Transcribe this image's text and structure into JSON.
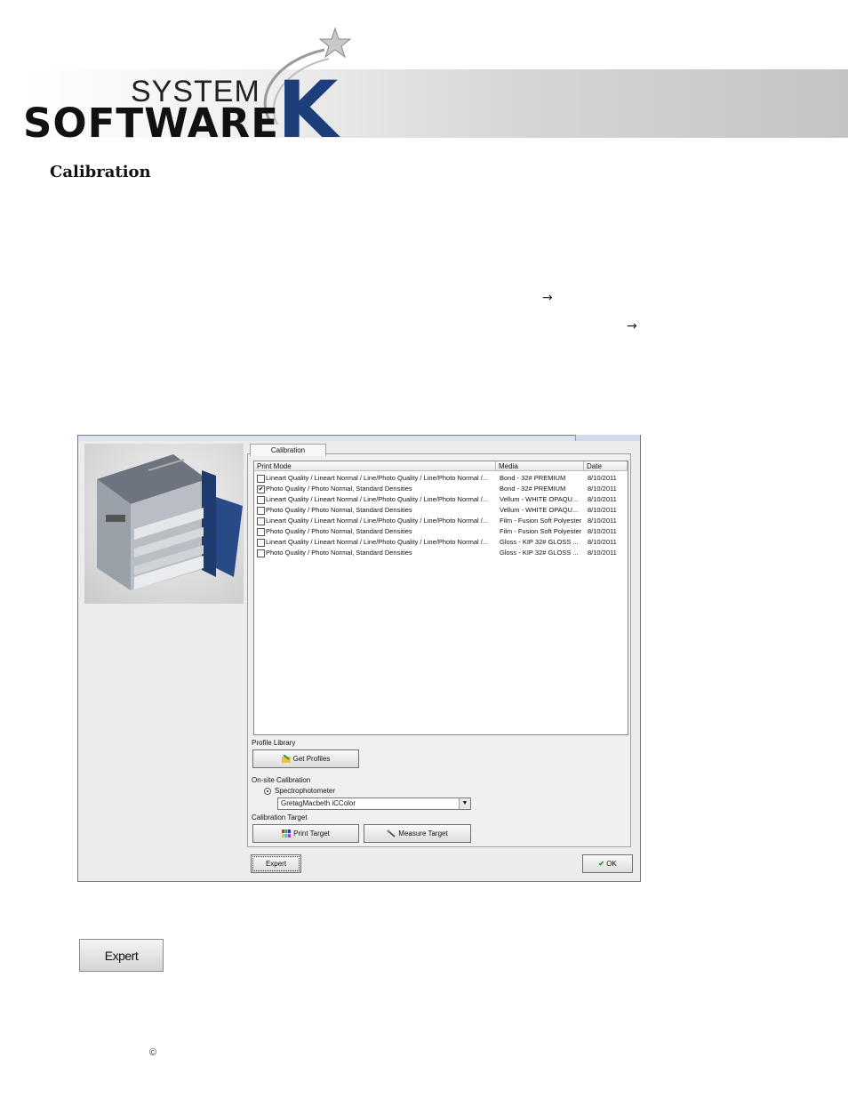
{
  "header": {
    "logo_system": "SYSTEM",
    "logo_software": "SOFTWARE",
    "logo_k": "K"
  },
  "page": {
    "title": "Calibration",
    "arrow_1": "→",
    "arrow_2": "→",
    "copyright": "©"
  },
  "dialog": {
    "tab": "Calibration",
    "columns": [
      "Print Mode",
      "Media",
      "Date"
    ],
    "rows": [
      {
        "checked": false,
        "mode": "Lineart Quality / Lineart Normal / Line/Photo Quality / Line/Photo Normal /...",
        "media": "Bond - 32# PREMIUM",
        "date": "8/10/2011"
      },
      {
        "checked": true,
        "mode": "Photo Quality / Photo Normal, Standard Densities",
        "media": "Bond - 32# PREMIUM",
        "date": "8/10/2011"
      },
      {
        "checked": false,
        "mode": "Lineart Quality / Lineart Normal / Line/Photo Quality / Line/Photo Normal /...",
        "media": "Vellum - WHITE OPAQU...",
        "date": "8/10/2011"
      },
      {
        "checked": false,
        "mode": "Photo Quality / Photo Normal, Standard Densities",
        "media": "Vellum - WHITE OPAQU...",
        "date": "8/10/2011"
      },
      {
        "checked": false,
        "mode": "Lineart Quality / Lineart Normal / Line/Photo Quality / Line/Photo Normal /...",
        "media": "Film - Fusion Soft Polyester",
        "date": "8/10/2011"
      },
      {
        "checked": false,
        "mode": "Photo Quality / Photo Normal, Standard Densities",
        "media": "Film - Fusion Soft Polyester",
        "date": "8/10/2011"
      },
      {
        "checked": false,
        "mode": "Lineart Quality / Lineart Normal / Line/Photo Quality / Line/Photo Normal /...",
        "media": "Gloss - KIP 32# GLOSS ...",
        "date": "8/10/2011"
      },
      {
        "checked": false,
        "mode": "Photo Quality / Photo Normal, Standard Densities",
        "media": "Gloss - KIP 32# GLOSS ...",
        "date": "8/10/2011"
      }
    ],
    "profile_library_label": "Profile Library",
    "get_profiles_button": "Get Profiles",
    "onsite_label": "On-site Calibration",
    "spectro_label": "Spectrophotometer",
    "device_select": "GretagMacbeth iCColor",
    "calibration_target_label": "Calibration Target",
    "print_target_button": "Print Target",
    "measure_target_button": "Measure Target",
    "expert_button": "Expert",
    "ok_button": "OK"
  },
  "expert_standalone_button": "Expert"
}
